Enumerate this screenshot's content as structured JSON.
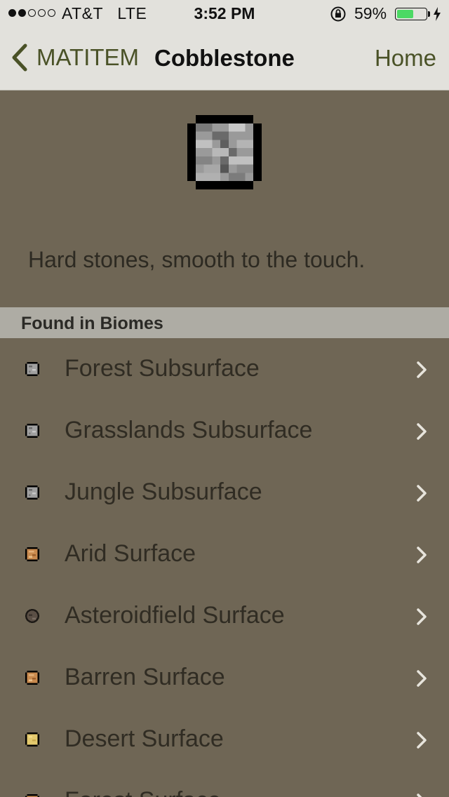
{
  "status": {
    "carrier": "AT&T",
    "network": "LTE",
    "time": "3:52 PM",
    "battery": "59%",
    "battery_level": 0.59
  },
  "nav": {
    "back_label": "MATITEM",
    "title": "Cobblestone",
    "home_label": "Home"
  },
  "item": {
    "description": "Hard stones, smooth to the touch."
  },
  "biomes": {
    "header": "Found in Biomes",
    "rows": [
      {
        "label": "Forest Subsurface",
        "icon": "stone-icon"
      },
      {
        "label": "Grasslands Subsurface",
        "icon": "stone-icon"
      },
      {
        "label": "Jungle Subsurface",
        "icon": "stone-icon"
      },
      {
        "label": "Arid Surface",
        "icon": "sandstone-icon"
      },
      {
        "label": "Asteroidfield Surface",
        "icon": "asteroid-icon"
      },
      {
        "label": "Barren Surface",
        "icon": "sandstone-icon"
      },
      {
        "label": "Desert Surface",
        "icon": "sand-icon"
      },
      {
        "label": "Forest Surface",
        "icon": "sandstone-icon"
      }
    ]
  },
  "colors": {
    "background": "#6f6655",
    "nav_tint": "#4a5227",
    "section_header": "#aeaca4",
    "battery_fill": "#4cd964"
  }
}
